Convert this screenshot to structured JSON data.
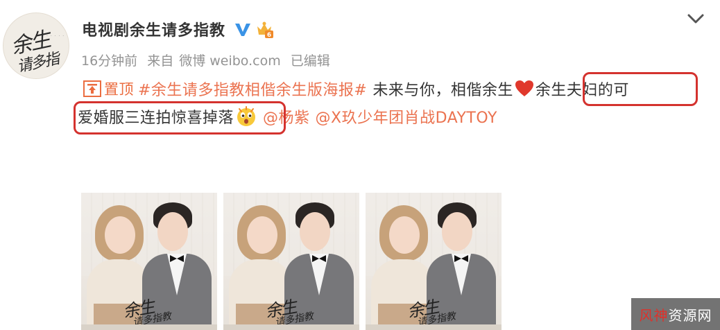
{
  "author": {
    "name": "电视剧余生请多指教",
    "avatar_logo_line1": "余生",
    "avatar_logo_line2": "请多指教",
    "verify_icon": "verified-v-icon",
    "rank_icon": "member-crown-icon"
  },
  "meta": {
    "time": "16分钟前",
    "from_label": "来自",
    "source": "微博 weibo.com",
    "edited": "已编辑"
  },
  "post": {
    "pin_label": "置顶",
    "line1": {
      "hashtag": "#余生请多指教相偕余生版海报#",
      "text_a": "未来与你，相偕余生",
      "text_b": "余生夫妇的可"
    },
    "line2": {
      "text_a": "爱婚服三连拍惊喜掉落",
      "mention1": "@杨紫",
      "mention2": "@X玖少年团肖战DAYTOY"
    },
    "heart_icon": "red-heart-icon",
    "emoji_icon": "surprised-face-emoji-icon"
  },
  "photos": [
    {
      "title": "余生",
      "subtitle": "请多指教"
    },
    {
      "title": "余生",
      "subtitle": "请多指教"
    },
    {
      "title": "余生",
      "subtitle": "请多指教"
    }
  ],
  "watermark": {
    "red_part": "风神",
    "white_part": "资源网"
  },
  "colors": {
    "link": "#eb7350",
    "meta": "#939393",
    "highlight": "#d4322e",
    "verify": "#3a93e6"
  }
}
